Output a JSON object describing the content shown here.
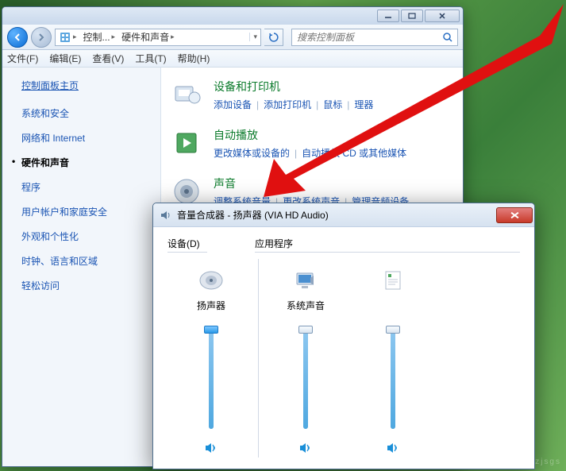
{
  "cp": {
    "addr": {
      "root": "控制...",
      "leaf": "硬件和声音"
    },
    "search_placeholder": "搜索控制面板",
    "menus": [
      "文件(F)",
      "编辑(E)",
      "查看(V)",
      "工具(T)",
      "帮助(H)"
    ],
    "home": "控制面板主页",
    "cats": [
      {
        "label": "系统和安全",
        "active": false
      },
      {
        "label": "网络和 Internet",
        "active": false
      },
      {
        "label": "硬件和声音",
        "active": true
      },
      {
        "label": "程序",
        "active": false
      },
      {
        "label": "用户帐户和家庭安全",
        "active": false
      },
      {
        "label": "外观和个性化",
        "active": false
      },
      {
        "label": "时钟、语言和区域",
        "active": false
      },
      {
        "label": "轻松访问",
        "active": false
      }
    ],
    "sections": [
      {
        "title": "设备和打印机",
        "links": [
          "添加设备",
          "添加打印机",
          "鼠标",
          "理器"
        ]
      },
      {
        "title": "自动播放",
        "links": [
          "更改媒体或设备的",
          "自动播放 CD 或其他媒体"
        ]
      },
      {
        "title": "声音",
        "links": [
          "调整系统音量",
          "更改系统声音",
          "管理音频设备"
        ]
      }
    ]
  },
  "vm": {
    "title": "音量合成器 - 扬声器 (VIA HD Audio)",
    "hdr_device": "设备(D)",
    "hdr_apps": "应用程序",
    "cols": [
      {
        "label": "扬声器",
        "level": 1.0,
        "thumb_blue": true
      },
      {
        "label": "系统声音",
        "level": 1.0,
        "thumb_blue": false
      },
      {
        "label": "",
        "level": 1.0,
        "thumb_blue": false
      }
    ]
  },
  "watermark": "www.wzjsgs"
}
